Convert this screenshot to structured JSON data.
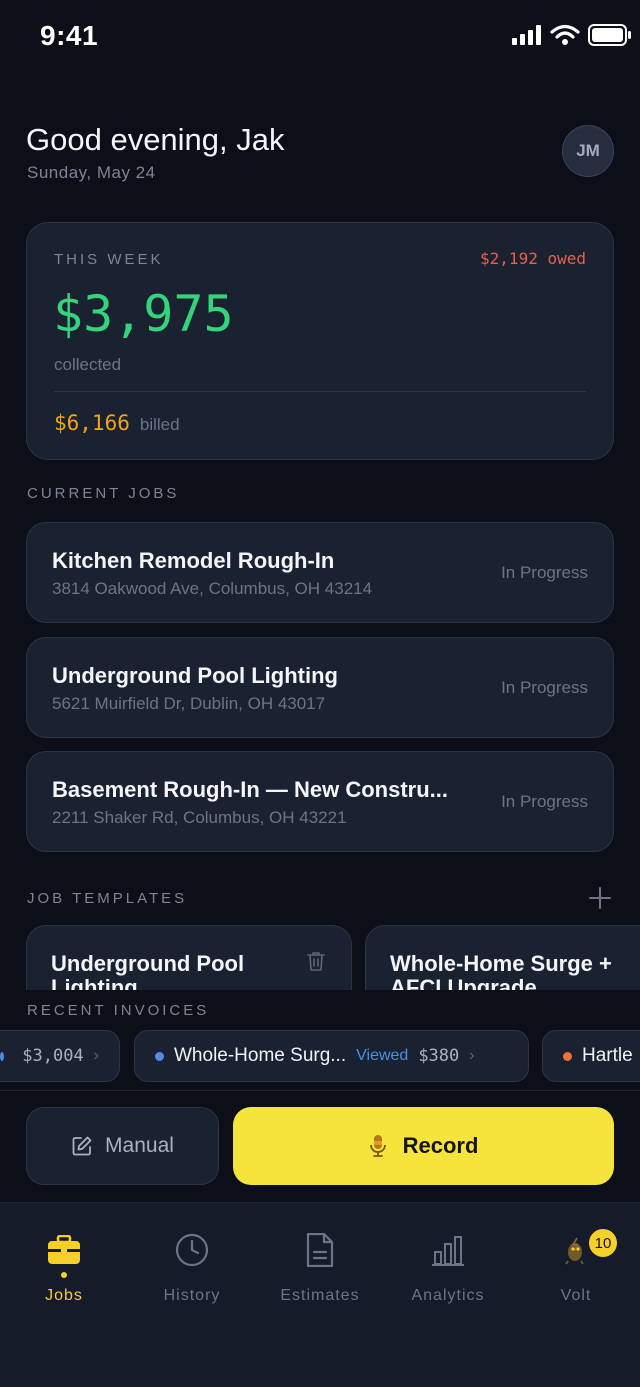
{
  "status_bar": {
    "time": "9:41"
  },
  "header": {
    "greeting": "Good evening, Jak",
    "date": "Sunday, May 24",
    "avatar_initials": "JM"
  },
  "week_summary": {
    "label": "THIS WEEK",
    "owed": "$2,192 owed",
    "collected_amount": "$3,975",
    "collected_label": "collected",
    "billed_amount": "$6,166",
    "billed_label": "billed"
  },
  "current_jobs": {
    "title": "CURRENT JOBS",
    "items": [
      {
        "title": "Kitchen Remodel Rough-In",
        "address": "3814 Oakwood Ave, Columbus, OH 43214",
        "status": "In Progress"
      },
      {
        "title": "Underground Pool Lighting",
        "address": "5621 Muirfield Dr, Dublin, OH 43017",
        "status": "In Progress"
      },
      {
        "title": "Basement Rough-In — New Constru...",
        "address": "2211 Shaker Rd, Columbus, OH 43221",
        "status": "In Progress"
      }
    ]
  },
  "job_templates": {
    "title": "JOB TEMPLATES",
    "items": [
      {
        "title": "Underground Pool Lighting"
      },
      {
        "title": "Whole-Home Surge + AFCI Upgrade"
      }
    ]
  },
  "recent_invoices": {
    "title": "RECENT INVOICES",
    "items": [
      {
        "name": "",
        "status": "",
        "amount": "$3,004",
        "dot_color": "#4a8fe8"
      },
      {
        "name": "Whole-Home Surg...",
        "status": "Viewed",
        "amount": "$380",
        "dot_color": "#4a8fe8"
      },
      {
        "name": "Hartle",
        "status": "",
        "amount": "",
        "dot_color": "#f2703a"
      }
    ]
  },
  "actions": {
    "manual_label": "Manual",
    "record_label": "Record"
  },
  "tabs": [
    {
      "label": "Jobs",
      "icon": "briefcase-icon",
      "active": true
    },
    {
      "label": "History",
      "icon": "clock-icon"
    },
    {
      "label": "Estimates",
      "icon": "document-icon"
    },
    {
      "label": "Analytics",
      "icon": "bar-chart-icon"
    },
    {
      "label": "Volt",
      "icon": "volt-mascot-icon",
      "badge": "10"
    }
  ],
  "colors": {
    "background": "#0c0f17",
    "card": "#1a2131",
    "accent_yellow": "#f5e43c",
    "collected_green": "#33d47c",
    "billed_orange": "#f0a516",
    "owed_red": "#e8604c",
    "viewed_blue": "#4a8fe8"
  }
}
